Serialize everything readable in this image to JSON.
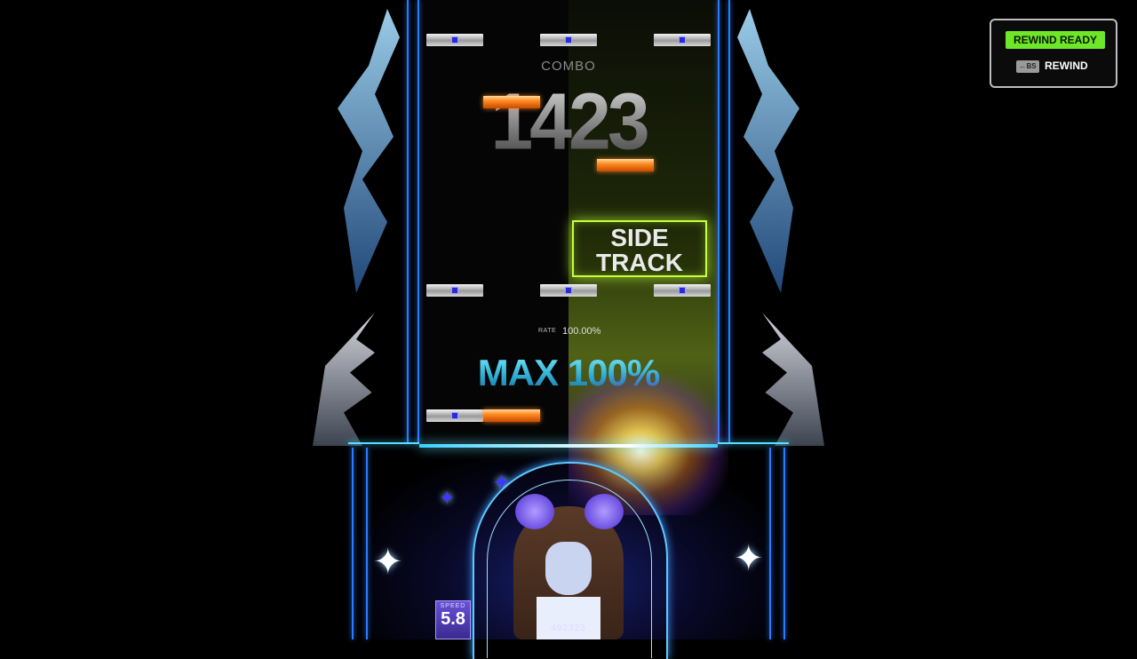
{
  "hud": {
    "combo_label": "COMBO",
    "combo_value": "1423",
    "side_track_line1": "SIDE",
    "side_track_line2": "TRACK",
    "rate_label": "RATE",
    "rate_value": "100.00%",
    "max_text": "MAX 100%",
    "speed_label": "SPEED",
    "speed_value": "5.8",
    "score": "492323"
  },
  "rewind": {
    "ready_label": "REWIND READY",
    "key_label": "←BS",
    "action_label": "REWIND"
  },
  "colors": {
    "accent_green": "#6ee62a",
    "lane_blue": "#2a7bff",
    "judge_line": "#5be0ff",
    "max_cyan": "#3fc8e8"
  }
}
